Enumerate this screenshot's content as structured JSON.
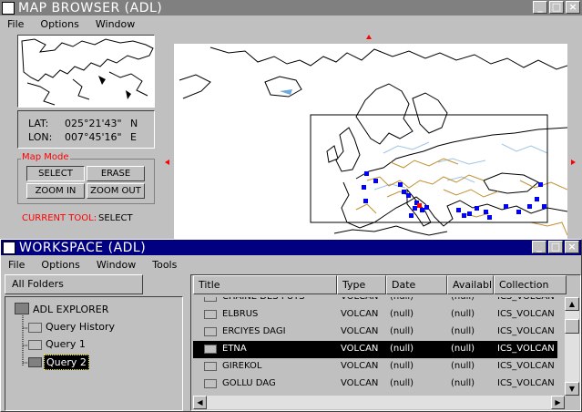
{
  "map_window": {
    "title": "MAP BROWSER (ADL)",
    "menu": [
      "File",
      "Options",
      "Window"
    ],
    "lat_label": "LAT:",
    "lat_value": "025°21'43\"",
    "lat_dir": "N",
    "lon_label": "LON:",
    "lon_value": "007°45'16\"",
    "lon_dir": "E",
    "map_mode_label": "Map Mode",
    "buttons": {
      "select": "SELECT",
      "erase": "ERASE",
      "zoom_in": "ZOOM IN",
      "zoom_out": "ZOOM OUT"
    },
    "current_tool_label": "CURRENT TOOL:",
    "current_tool_value": "SELECT",
    "colors": {
      "accent_red": "#ff0000",
      "point_blue": "#0000ff",
      "border_gold": "#c09030"
    }
  },
  "workspace_window": {
    "title": "WORKSPACE (ADL)",
    "menu": [
      "File",
      "Options",
      "Window",
      "Tools"
    ],
    "folders_tab": "All Folders",
    "tree": {
      "root": "ADL EXPLORER",
      "items": [
        "Query History",
        "Query 1",
        "Query 2"
      ],
      "selected": "Query 2"
    },
    "columns": [
      "Title",
      "Type",
      "Date",
      "Availabl",
      "Collection"
    ],
    "rows": [
      {
        "title": "CHAINE DES PUYS",
        "type": "VOLCAN",
        "date": "(null)",
        "avail": "(null)",
        "coll": "ICS_VOLCAN"
      },
      {
        "title": "ELBRUS",
        "type": "VOLCAN",
        "date": "(null)",
        "avail": "(null)",
        "coll": "ICS_VOLCAN"
      },
      {
        "title": "ERCIYES DAGI",
        "type": "VOLCAN",
        "date": "(null)",
        "avail": "(null)",
        "coll": "ICS_VOLCAN"
      },
      {
        "title": "ETNA",
        "type": "VOLCAN",
        "date": "(null)",
        "avail": "(null)",
        "coll": "ICS_VOLCAN",
        "selected": true
      },
      {
        "title": "GIREKOL",
        "type": "VOLCAN",
        "date": "(null)",
        "avail": "(null)",
        "coll": "ICS_VOLCAN"
      },
      {
        "title": "GOLLU DAG",
        "type": "VOLCAN",
        "date": "(null)",
        "avail": "(null)",
        "coll": "ICS_VOLCAN"
      }
    ],
    "colors": {
      "title_bar": "#000080",
      "selection": "#000000"
    }
  }
}
